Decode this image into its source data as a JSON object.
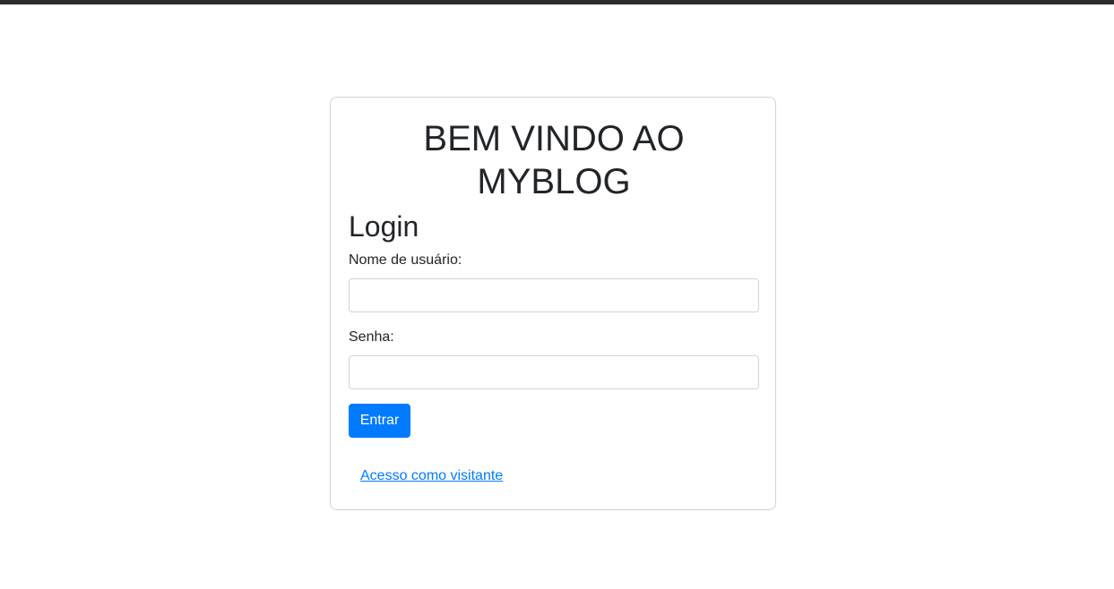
{
  "page": {
    "title_line1": "BEM VINDO AO",
    "title_line2": "MYBLOG"
  },
  "login": {
    "heading": "Login",
    "username_label": "Nome de usuário:",
    "username_value": "",
    "password_label": "Senha:",
    "password_value": "",
    "submit_label": "Entrar",
    "guest_link": "Acesso como visitante"
  },
  "colors": {
    "primary": "#007bff",
    "text": "#212529",
    "border": "#ced4da",
    "topbar": "#2b2b2b"
  }
}
